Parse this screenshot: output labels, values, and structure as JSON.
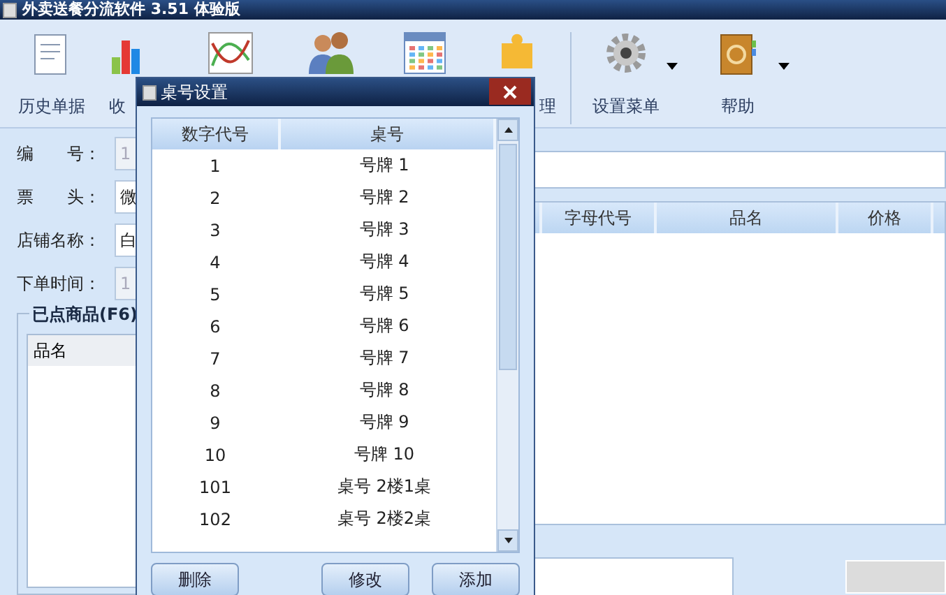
{
  "window": {
    "title": "外卖送餐分流软件 3.51 体验版"
  },
  "toolbar": [
    {
      "kind": "document",
      "label": "历史单据",
      "dropdown": false
    },
    {
      "kind": "bar-chart",
      "label": "收",
      "dropdown": false
    },
    {
      "kind": "line-chart",
      "dropdown": false
    },
    {
      "kind": "people",
      "dropdown": false
    },
    {
      "kind": "calendar",
      "dropdown": false
    },
    {
      "kind": "puzzle",
      "label": "理",
      "dropdown": false
    },
    {
      "kind": "gear",
      "label": "设置菜单",
      "dropdown": true
    },
    {
      "kind": "address-book",
      "label": "帮助",
      "dropdown": true
    }
  ],
  "form": [
    {
      "label": "编　　号：",
      "value": "1",
      "disabled": true
    },
    {
      "label": "票　　头：",
      "value": "微",
      "disabled": false
    },
    {
      "label": "店铺名称：",
      "value": "白",
      "disabled": false
    },
    {
      "label": "下单时间：",
      "value": "1",
      "disabled": true
    }
  ],
  "ordered_group": {
    "title": "已点商品(F6)",
    "columns": [
      "品名"
    ]
  },
  "menu_table": {
    "columns": [
      "字母代号",
      "品名",
      "价格"
    ]
  },
  "dialog": {
    "title": "桌号设置",
    "columns": [
      "数字代号",
      "桌号"
    ],
    "rows": [
      {
        "code": "1",
        "name": "号牌 1"
      },
      {
        "code": "2",
        "name": "号牌 2"
      },
      {
        "code": "3",
        "name": "号牌 3"
      },
      {
        "code": "4",
        "name": "号牌 4"
      },
      {
        "code": "5",
        "name": "号牌 5"
      },
      {
        "code": "6",
        "name": "号牌 6"
      },
      {
        "code": "7",
        "name": "号牌 7"
      },
      {
        "code": "8",
        "name": "号牌 8"
      },
      {
        "code": "9",
        "name": "号牌 9"
      },
      {
        "code": "10",
        "name": "号牌 10"
      },
      {
        "code": "101",
        "name": "桌号 2楼1桌"
      },
      {
        "code": "102",
        "name": "桌号 2楼2桌"
      }
    ],
    "buttons": [
      "删除",
      "修改",
      "添加"
    ]
  }
}
